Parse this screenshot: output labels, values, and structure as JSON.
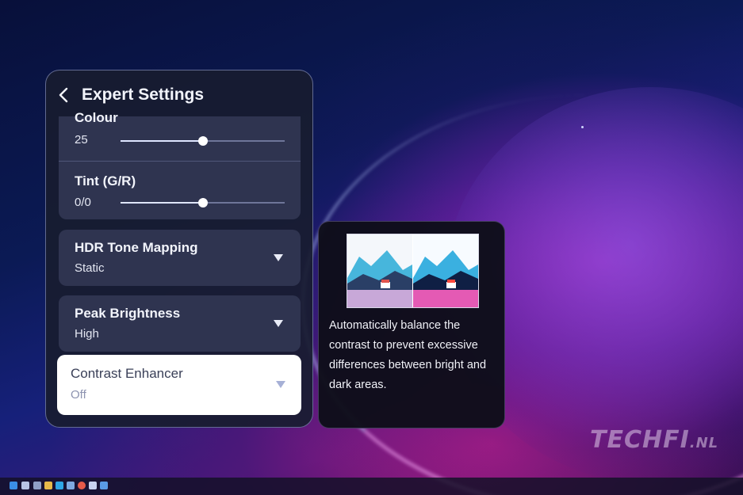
{
  "panel": {
    "title": "Expert Settings",
    "sliders": [
      {
        "label": "Colour",
        "value": "25",
        "level_percent": 50
      },
      {
        "label": "Tint (G/R)",
        "value": "0/0",
        "level_percent": 50
      }
    ],
    "dropdowns": [
      {
        "label": "HDR Tone Mapping",
        "value": "Static"
      },
      {
        "label": "Peak Brightness",
        "value": "High"
      },
      {
        "label": "Contrast Enhancer",
        "value": "Off"
      }
    ]
  },
  "info": {
    "description": "Automatically balance the contrast to prevent excessive differences between bright and dark areas."
  },
  "watermark": {
    "main": "TECHFI",
    "suffix": ".NL"
  },
  "taskbar": {
    "icons": [
      "windows-start-icon",
      "search-icon",
      "file-explorer-icon",
      "folder-icon",
      "edge-icon",
      "mail-icon",
      "chrome-icon",
      "photos-icon",
      "app-icon",
      "settings-icon"
    ]
  },
  "colors": {
    "accent": "#ffffff",
    "slider_fill": "#dfe6ff",
    "panel_bg": "#2f3450",
    "selected_bg": "#ffffff"
  }
}
